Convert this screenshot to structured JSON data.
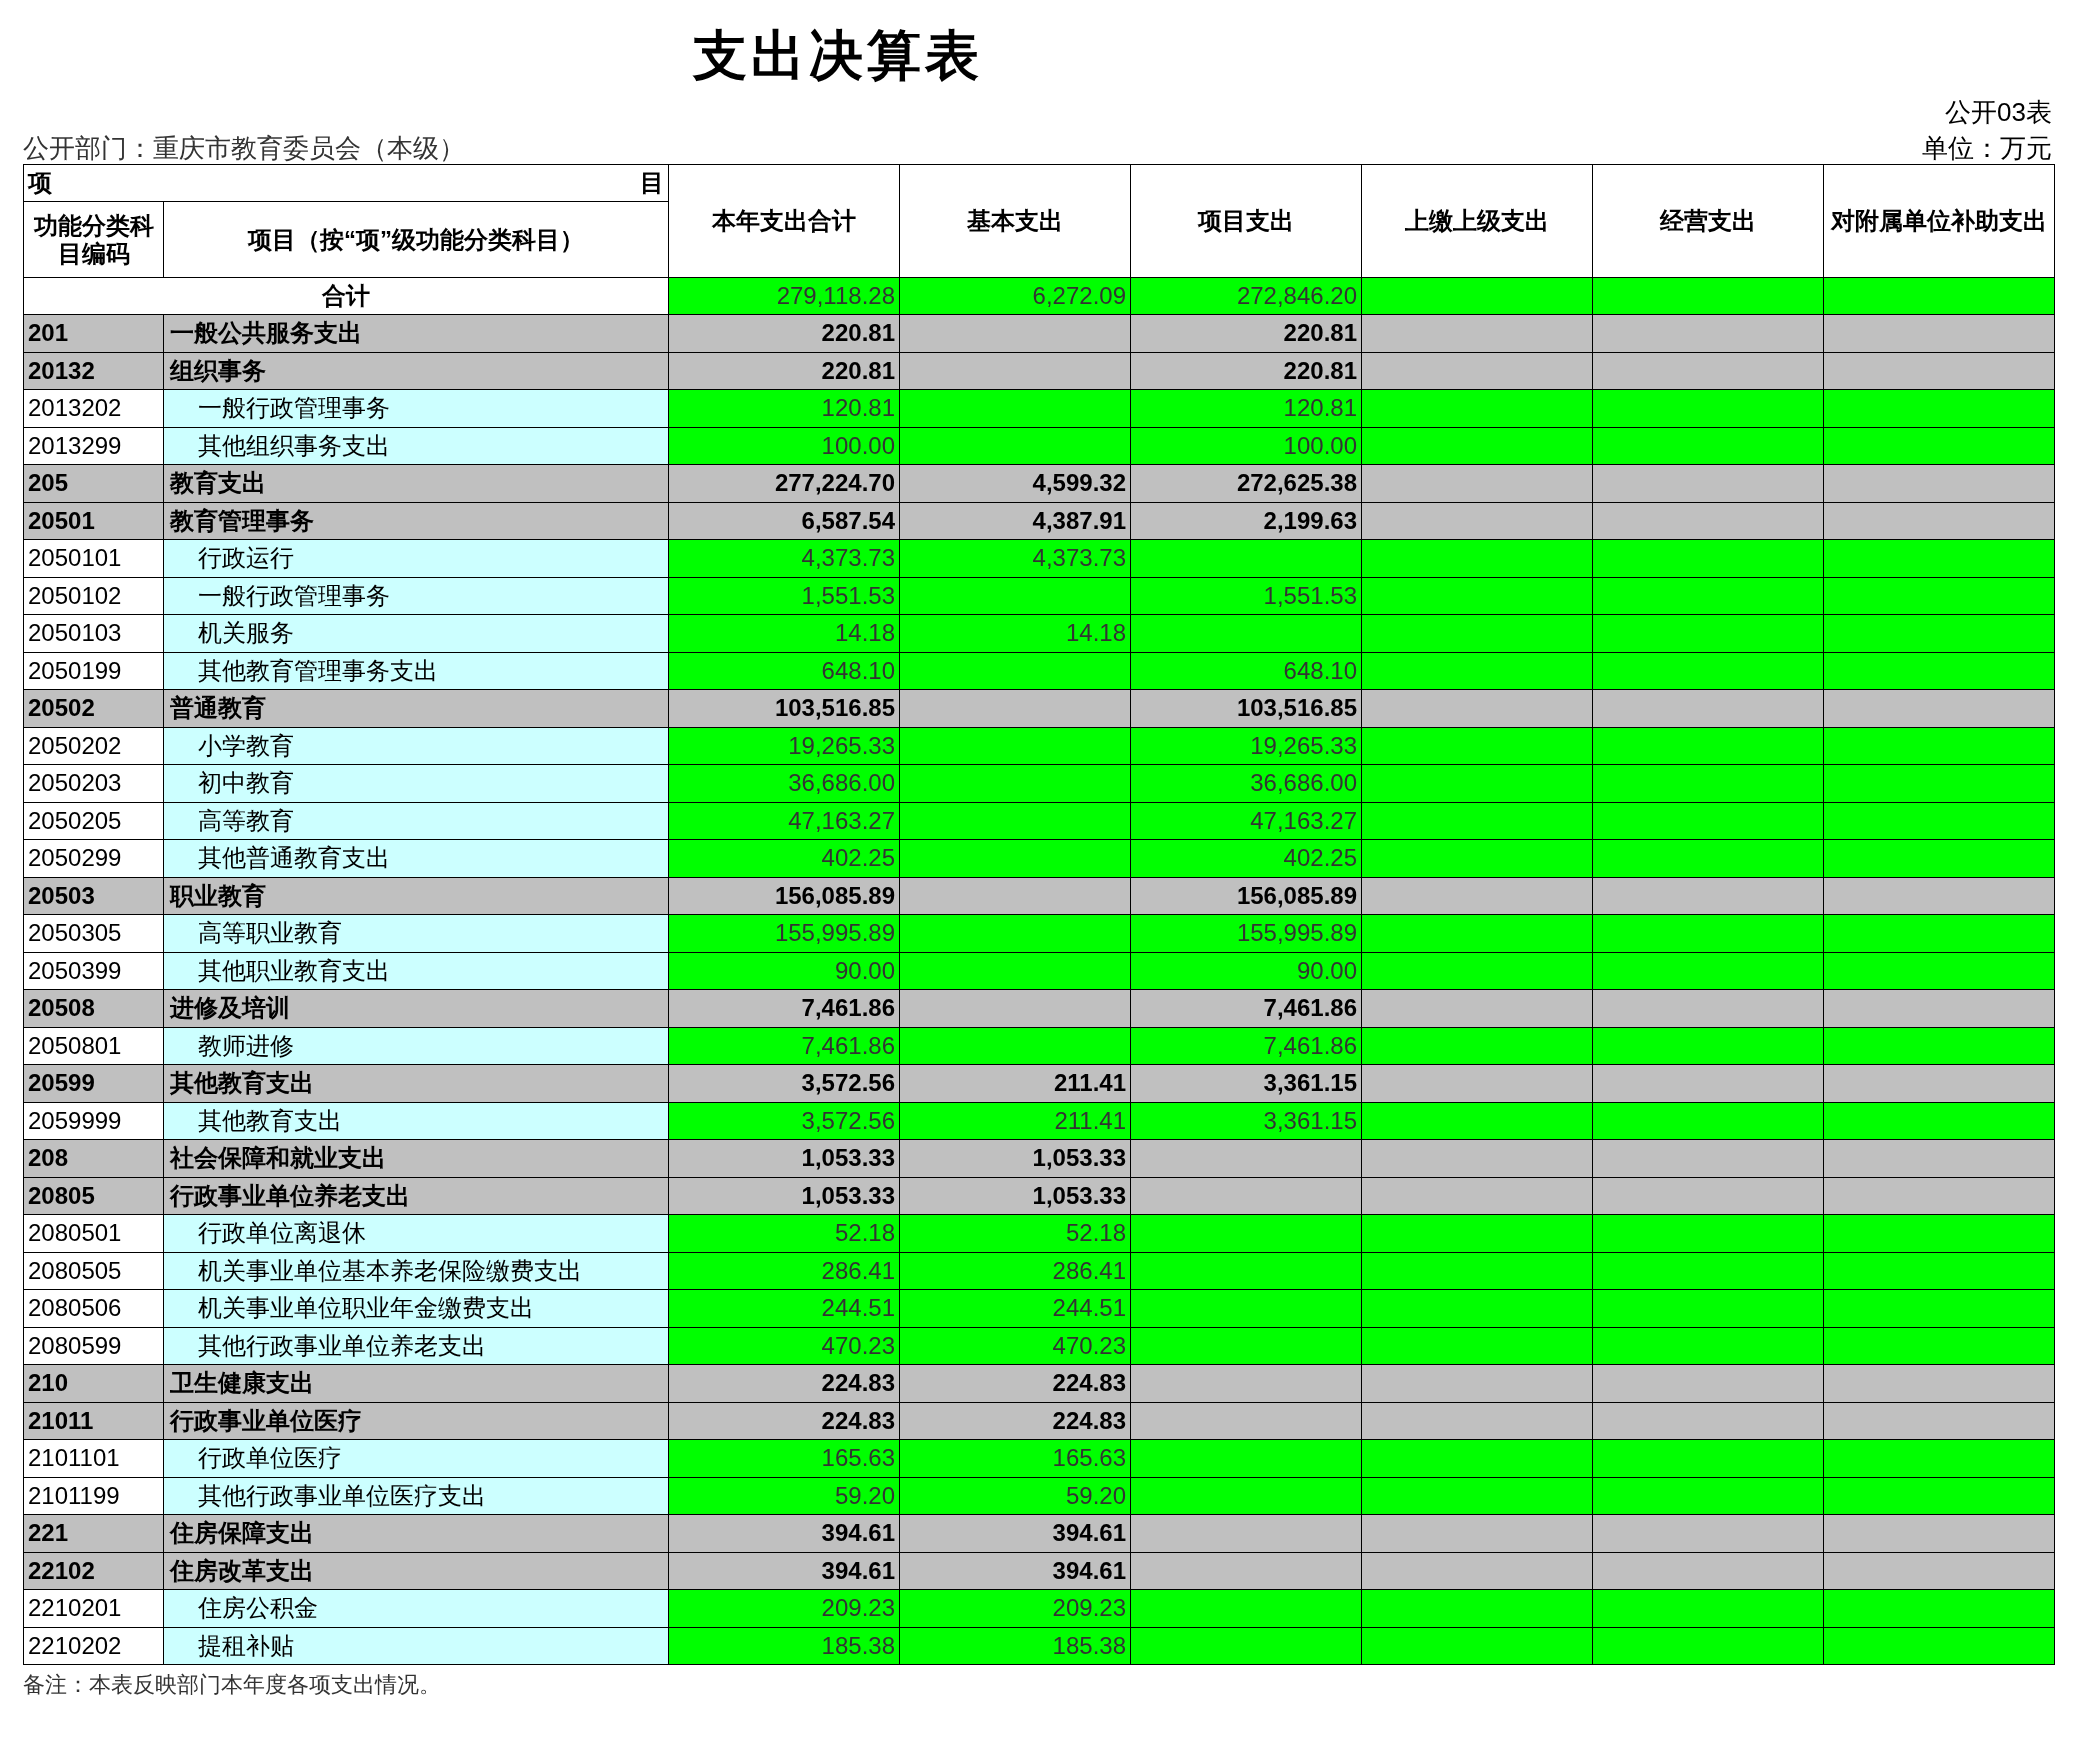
{
  "title": "支出决算表",
  "form_no": "公开03表",
  "department": "公开部门：重庆市教育委员会（本级）",
  "unit": "单位：万元",
  "table": {
    "group_header": {
      "left": "项",
      "right": "目"
    },
    "columns": [
      "功能分类科目编码",
      "项目（按“项”级功能分类科目）",
      "本年支出合计",
      "基本支出",
      "项目支出",
      "上缴上级支出",
      "经营支出",
      "对附属单位补助支出"
    ],
    "total_row": {
      "label": "合计",
      "total": "279,118.28",
      "basic": "6,272.09",
      "project": "272,846.20"
    },
    "rows": [
      {
        "kind": "summary",
        "code": "201",
        "name": "一般公共服务支出",
        "total": "220.81",
        "project": "220.81"
      },
      {
        "kind": "summary",
        "code": "20132",
        "name": "组织事务",
        "total": "220.81",
        "project": "220.81"
      },
      {
        "kind": "detail",
        "code": "2013202",
        "name": "一般行政管理事务",
        "total": "120.81",
        "project": "120.81"
      },
      {
        "kind": "detail",
        "code": "2013299",
        "name": "其他组织事务支出",
        "total": "100.00",
        "project": "100.00"
      },
      {
        "kind": "summary",
        "code": "205",
        "name": "教育支出",
        "total": "277,224.70",
        "basic": "4,599.32",
        "project": "272,625.38"
      },
      {
        "kind": "summary",
        "code": "20501",
        "name": "教育管理事务",
        "total": "6,587.54",
        "basic": "4,387.91",
        "project": "2,199.63"
      },
      {
        "kind": "detail",
        "code": "2050101",
        "name": "行政运行",
        "total": "4,373.73",
        "basic": "4,373.73"
      },
      {
        "kind": "detail",
        "code": "2050102",
        "name": "一般行政管理事务",
        "total": "1,551.53",
        "project": "1,551.53"
      },
      {
        "kind": "detail",
        "code": "2050103",
        "name": "机关服务",
        "total": "14.18",
        "basic": "14.18"
      },
      {
        "kind": "detail",
        "code": "2050199",
        "name": "其他教育管理事务支出",
        "total": "648.10",
        "project": "648.10"
      },
      {
        "kind": "summary",
        "code": "20502",
        "name": "普通教育",
        "total": "103,516.85",
        "project": "103,516.85"
      },
      {
        "kind": "detail",
        "code": "2050202",
        "name": "小学教育",
        "total": "19,265.33",
        "project": "19,265.33"
      },
      {
        "kind": "detail",
        "code": "2050203",
        "name": "初中教育",
        "total": "36,686.00",
        "project": "36,686.00"
      },
      {
        "kind": "detail",
        "code": "2050205",
        "name": "高等教育",
        "total": "47,163.27",
        "project": "47,163.27"
      },
      {
        "kind": "detail",
        "code": "2050299",
        "name": "其他普通教育支出",
        "total": "402.25",
        "project": "402.25"
      },
      {
        "kind": "summary",
        "code": "20503",
        "name": "职业教育",
        "total": "156,085.89",
        "project": "156,085.89"
      },
      {
        "kind": "detail",
        "code": "2050305",
        "name": "高等职业教育",
        "total": "155,995.89",
        "project": "155,995.89"
      },
      {
        "kind": "detail",
        "code": "2050399",
        "name": "其他职业教育支出",
        "total": "90.00",
        "project": "90.00"
      },
      {
        "kind": "summary",
        "code": "20508",
        "name": "进修及培训",
        "total": "7,461.86",
        "project": "7,461.86"
      },
      {
        "kind": "detail",
        "code": "2050801",
        "name": "教师进修",
        "total": "7,461.86",
        "project": "7,461.86"
      },
      {
        "kind": "summary",
        "code": "20599",
        "name": "其他教育支出",
        "total": "3,572.56",
        "basic": "211.41",
        "project": "3,361.15"
      },
      {
        "kind": "detail",
        "code": "2059999",
        "name": "其他教育支出",
        "total": "3,572.56",
        "basic": "211.41",
        "project": "3,361.15"
      },
      {
        "kind": "summary",
        "code": "208",
        "name": "社会保障和就业支出",
        "total": "1,053.33",
        "basic": "1,053.33"
      },
      {
        "kind": "summary",
        "code": "20805",
        "name": "行政事业单位养老支出",
        "total": "1,053.33",
        "basic": "1,053.33"
      },
      {
        "kind": "detail",
        "code": "2080501",
        "name": "行政单位离退休",
        "total": "52.18",
        "basic": "52.18"
      },
      {
        "kind": "detail",
        "code": "2080505",
        "name": "机关事业单位基本养老保险缴费支出",
        "total": "286.41",
        "basic": "286.41"
      },
      {
        "kind": "detail",
        "code": "2080506",
        "name": "机关事业单位职业年金缴费支出",
        "total": "244.51",
        "basic": "244.51"
      },
      {
        "kind": "detail",
        "code": "2080599",
        "name": "其他行政事业单位养老支出",
        "total": "470.23",
        "basic": "470.23"
      },
      {
        "kind": "summary",
        "code": "210",
        "name": "卫生健康支出",
        "total": "224.83",
        "basic": "224.83"
      },
      {
        "kind": "summary",
        "code": "21011",
        "name": "行政事业单位医疗",
        "total": "224.83",
        "basic": "224.83"
      },
      {
        "kind": "detail",
        "code": "2101101",
        "name": "行政单位医疗",
        "total": "165.63",
        "basic": "165.63"
      },
      {
        "kind": "detail",
        "code": "2101199",
        "name": "其他行政事业单位医疗支出",
        "total": "59.20",
        "basic": "59.20"
      },
      {
        "kind": "summary",
        "code": "221",
        "name": "住房保障支出",
        "total": "394.61",
        "basic": "394.61"
      },
      {
        "kind": "summary",
        "code": "22102",
        "name": "住房改革支出",
        "total": "394.61",
        "basic": "394.61"
      },
      {
        "kind": "detail",
        "code": "2210201",
        "name": "住房公积金",
        "total": "209.23",
        "basic": "209.23"
      },
      {
        "kind": "detail",
        "code": "2210202",
        "name": "提租补贴",
        "total": "185.38",
        "basic": "185.38"
      }
    ]
  },
  "note": "备注：本表反映部门本年度各项支出情况。"
}
